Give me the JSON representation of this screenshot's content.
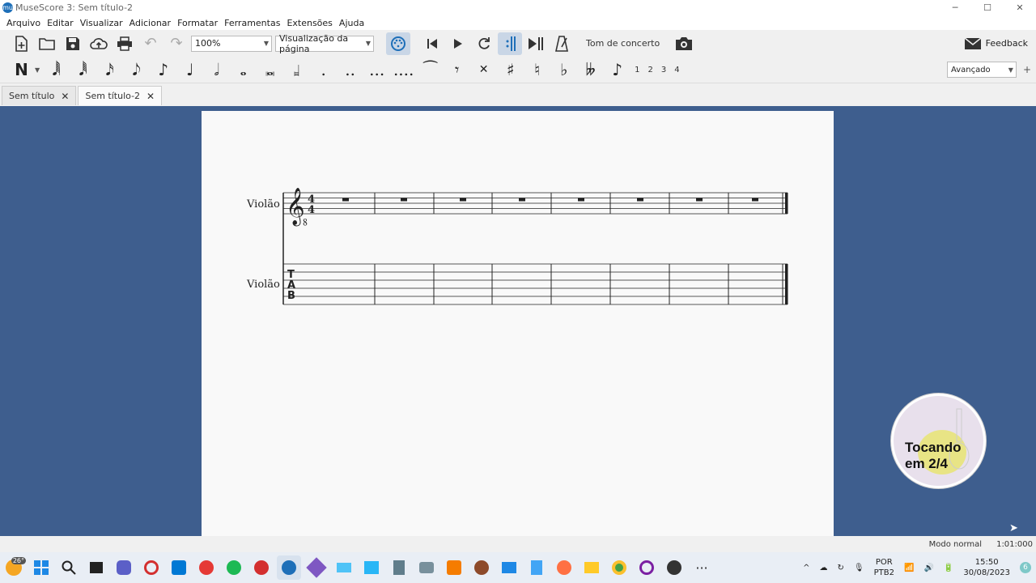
{
  "window": {
    "title": "MuseScore 3: Sem título-2",
    "logo": "mu"
  },
  "window_controls": {
    "minimize": "─",
    "maximize": "☐",
    "close": "✕"
  },
  "menu": [
    "Arquivo",
    "Editar",
    "Visualizar",
    "Adicionar",
    "Formatar",
    "Ferramentas",
    "Extensões",
    "Ajuda"
  ],
  "toolbar": {
    "zoom": "100%",
    "view_mode": "Visualização da página",
    "concert_pitch": "Tom de concerto",
    "feedback": "Feedback"
  },
  "note_input": {
    "voices": [
      "1",
      "2",
      "3",
      "4"
    ],
    "workspace": "Avançado"
  },
  "tabs": [
    {
      "label": "Sem título",
      "close": "✕"
    },
    {
      "label": "Sem título-2",
      "close": "✕"
    }
  ],
  "score": {
    "staff1_name": "Violão",
    "staff2_name": "Violão",
    "time_sig_top": "4",
    "time_sig_bottom": "4",
    "tab_letters": [
      "T",
      "A",
      "B"
    ],
    "measures": 8
  },
  "badge": {
    "line1": "Tocando",
    "line2": "em 2/4"
  },
  "status": {
    "mode": "Modo normal",
    "time": "1:01:000"
  },
  "taskbar": {
    "weather": "26°",
    "tray_lang1": "POR",
    "tray_lang2": "PTB2",
    "time": "15:50",
    "date": "30/08/2023",
    "notif_count": "6",
    "more": "···",
    "tray_up": "^"
  }
}
